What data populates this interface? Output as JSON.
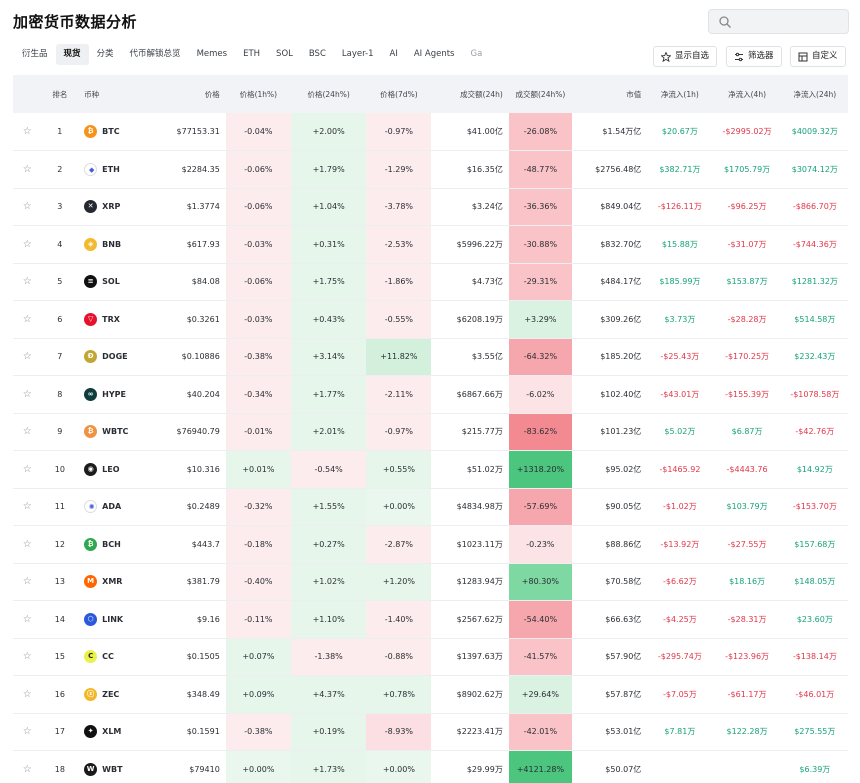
{
  "title": "加密货币数据分析",
  "search": {
    "placeholder": ""
  },
  "tabs": [
    {
      "label": "衍生品",
      "active": false
    },
    {
      "label": "现货",
      "active": true
    },
    {
      "label": "分类",
      "active": false
    },
    {
      "label": "代币解锁总览",
      "active": false
    },
    {
      "label": "Memes",
      "active": false
    },
    {
      "label": "ETH",
      "active": false
    },
    {
      "label": "SOL",
      "active": false
    },
    {
      "label": "BSC",
      "active": false
    },
    {
      "label": "Layer-1",
      "active": false
    },
    {
      "label": "AI",
      "active": false
    },
    {
      "label": "AI Agents",
      "active": false
    },
    {
      "label": "Ga",
      "active": false
    }
  ],
  "toolbar": {
    "watchlist_label": "显示自选",
    "filter_label": "筛选器",
    "custom_label": "自定义"
  },
  "columns": [
    "排名",
    "币种",
    "价格",
    "价格(1h%)",
    "价格(24h%)",
    "价格(7d%)",
    "成交额(24h)",
    "成交额(24h%)",
    "市值",
    "净流入(1h)",
    "净流入(4h)",
    "净流入(24h)"
  ],
  "colors": {
    "pos_text": "#16a37a",
    "neg_text": "#e2364a",
    "header_bg": "#f1f3f6"
  },
  "rows": [
    {
      "rank": "1",
      "symbol": "BTC",
      "icon": "btc-coin-icon",
      "color": "#f7931a",
      "glyph": "₿",
      "price": "$77153.31",
      "h1": "-0.04%",
      "h24": "+2.00%",
      "d7": "-0.97%",
      "vol": "$41.00亿",
      "volp": "-26.08%",
      "mcap": "$1.54万亿",
      "in1": "$20.67万",
      "in4": "-$2995.02万",
      "in24": "$4009.32万"
    },
    {
      "rank": "2",
      "symbol": "ETH",
      "icon": "eth-coin-icon",
      "color": "#ffffff",
      "glyph": "◆",
      "price": "$2284.35",
      "h1": "-0.06%",
      "h24": "+1.79%",
      "d7": "-1.29%",
      "vol": "$16.35亿",
      "volp": "-48.77%",
      "mcap": "$2756.48亿",
      "in1": "$382.71万",
      "in4": "$1705.79万",
      "in24": "$3074.12万"
    },
    {
      "rank": "3",
      "symbol": "XRP",
      "icon": "xrp-coin-icon",
      "color": "#23292f",
      "glyph": "✕",
      "price": "$1.3774",
      "h1": "-0.06%",
      "h24": "+1.04%",
      "d7": "-3.78%",
      "vol": "$3.24亿",
      "volp": "-36.36%",
      "mcap": "$849.04亿",
      "in1": "-$126.11万",
      "in4": "-$96.25万",
      "in24": "-$866.70万"
    },
    {
      "rank": "4",
      "symbol": "BNB",
      "icon": "bnb-coin-icon",
      "color": "#f3ba2f",
      "glyph": "◈",
      "price": "$617.93",
      "h1": "-0.03%",
      "h24": "+0.31%",
      "d7": "-2.53%",
      "vol": "$5996.22万",
      "volp": "-30.88%",
      "mcap": "$832.70亿",
      "in1": "$15.88万",
      "in4": "-$31.07万",
      "in24": "-$744.36万"
    },
    {
      "rank": "5",
      "symbol": "SOL",
      "icon": "sol-coin-icon",
      "color": "#111111",
      "glyph": "≡",
      "price": "$84.08",
      "h1": "-0.06%",
      "h24": "+1.75%",
      "d7": "-1.86%",
      "vol": "$4.73亿",
      "volp": "-29.31%",
      "mcap": "$484.17亿",
      "in1": "$185.99万",
      "in4": "$153.87万",
      "in24": "$1281.32万"
    },
    {
      "rank": "6",
      "symbol": "TRX",
      "icon": "trx-coin-icon",
      "color": "#e8112d",
      "glyph": "▽",
      "price": "$0.3261",
      "h1": "-0.03%",
      "h24": "+0.43%",
      "d7": "-0.55%",
      "vol": "$6208.19万",
      "volp": "+3.29%",
      "mcap": "$309.26亿",
      "in1": "$3.73万",
      "in4": "-$28.28万",
      "in24": "$514.58万"
    },
    {
      "rank": "7",
      "symbol": "DOGE",
      "icon": "doge-coin-icon",
      "color": "#c2a633",
      "glyph": "Ð",
      "price": "$0.10886",
      "h1": "-0.38%",
      "h24": "+3.14%",
      "d7": "+11.82%",
      "vol": "$3.55亿",
      "volp": "-64.32%",
      "mcap": "$185.20亿",
      "in1": "-$25.43万",
      "in4": "-$170.25万",
      "in24": "$232.43万"
    },
    {
      "rank": "8",
      "symbol": "HYPE",
      "icon": "hype-coin-icon",
      "color": "#0f3d3e",
      "glyph": "∞",
      "price": "$40.204",
      "h1": "-0.34%",
      "h24": "+1.77%",
      "d7": "-2.11%",
      "vol": "$6867.66万",
      "volp": "-6.02%",
      "mcap": "$102.40亿",
      "in1": "-$43.01万",
      "in4": "-$155.39万",
      "in24": "-$1078.58万"
    },
    {
      "rank": "9",
      "symbol": "WBTC",
      "icon": "wbtc-coin-icon",
      "color": "#f09242",
      "glyph": "₿",
      "price": "$76940.79",
      "h1": "-0.01%",
      "h24": "+2.01%",
      "d7": "-0.97%",
      "vol": "$215.77万",
      "volp": "-83.62%",
      "mcap": "$101.23亿",
      "in1": "$5.02万",
      "in4": "$6.87万",
      "in24": "-$42.76万"
    },
    {
      "rank": "10",
      "symbol": "LEO",
      "icon": "leo-coin-icon",
      "color": "#1c1c1c",
      "glyph": "◉",
      "price": "$10.316",
      "h1": "+0.01%",
      "h24": "-0.54%",
      "d7": "+0.55%",
      "vol": "$51.02万",
      "volp": "+1318.20%",
      "mcap": "$95.02亿",
      "in1": "-$1465.92",
      "in4": "-$4443.76",
      "in24": "$14.92万"
    },
    {
      "rank": "11",
      "symbol": "ADA",
      "icon": "ada-coin-icon",
      "color": "#ffffff",
      "glyph": "✺",
      "price": "$0.2489",
      "h1": "-0.32%",
      "h24": "+1.55%",
      "d7": "+0.00%",
      "vol": "$4834.98万",
      "volp": "-57.69%",
      "mcap": "$90.05亿",
      "in1": "-$1.02万",
      "in4": "$103.79万",
      "in24": "-$153.70万"
    },
    {
      "rank": "12",
      "symbol": "BCH",
      "icon": "bch-coin-icon",
      "color": "#2fa84f",
      "glyph": "₿",
      "price": "$443.7",
      "h1": "-0.18%",
      "h24": "+0.27%",
      "d7": "-2.87%",
      "vol": "$1023.11万",
      "volp": "-0.23%",
      "mcap": "$88.86亿",
      "in1": "-$13.92万",
      "in4": "-$27.55万",
      "in24": "$157.68万"
    },
    {
      "rank": "13",
      "symbol": "XMR",
      "icon": "xmr-coin-icon",
      "color": "#ff6600",
      "glyph": "M",
      "price": "$381.79",
      "h1": "-0.40%",
      "h24": "+1.02%",
      "d7": "+1.20%",
      "vol": "$1283.94万",
      "volp": "+80.30%",
      "mcap": "$70.58亿",
      "in1": "-$6.62万",
      "in4": "$18.16万",
      "in24": "$148.05万"
    },
    {
      "rank": "14",
      "symbol": "LINK",
      "icon": "link-coin-icon",
      "color": "#2a5ada",
      "glyph": "⬡",
      "price": "$9.16",
      "h1": "-0.11%",
      "h24": "+1.10%",
      "d7": "-1.40%",
      "vol": "$2567.62万",
      "volp": "-54.40%",
      "mcap": "$66.63亿",
      "in1": "-$4.25万",
      "in4": "-$28.31万",
      "in24": "$23.60万"
    },
    {
      "rank": "15",
      "symbol": "CC",
      "icon": "cc-coin-icon",
      "color": "#e8f24a",
      "glyph": "C",
      "price": "$0.1505",
      "h1": "+0.07%",
      "h24": "-1.38%",
      "d7": "-0.88%",
      "vol": "$1397.63万",
      "volp": "-41.57%",
      "mcap": "$57.90亿",
      "in1": "-$295.74万",
      "in4": "-$123.96万",
      "in24": "-$138.14万"
    },
    {
      "rank": "16",
      "symbol": "ZEC",
      "icon": "zec-coin-icon",
      "color": "#f4b728",
      "glyph": "ⓩ",
      "price": "$348.49",
      "h1": "+0.09%",
      "h24": "+4.37%",
      "d7": "+0.78%",
      "vol": "$8902.62万",
      "volp": "+29.64%",
      "mcap": "$57.87亿",
      "in1": "-$7.05万",
      "in4": "-$61.17万",
      "in24": "-$46.01万"
    },
    {
      "rank": "17",
      "symbol": "XLM",
      "icon": "xlm-coin-icon",
      "color": "#111111",
      "glyph": "✦",
      "price": "$0.1591",
      "h1": "-0.38%",
      "h24": "+0.19%",
      "d7": "-8.93%",
      "vol": "$2223.41万",
      "volp": "-42.01%",
      "mcap": "$53.01亿",
      "in1": "$7.81万",
      "in4": "$122.28万",
      "in24": "$275.55万"
    },
    {
      "rank": "18",
      "symbol": "WBT",
      "icon": "wbt-coin-icon",
      "color": "#1a1a1a",
      "glyph": "W",
      "price": "$79410",
      "h1": "+0.00%",
      "h24": "+1.73%",
      "d7": "+0.00%",
      "vol": "$29.99万",
      "volp": "+4121.28%",
      "mcap": "$50.07亿",
      "in1": "",
      "in4": "",
      "in24": "$6.39万"
    }
  ]
}
